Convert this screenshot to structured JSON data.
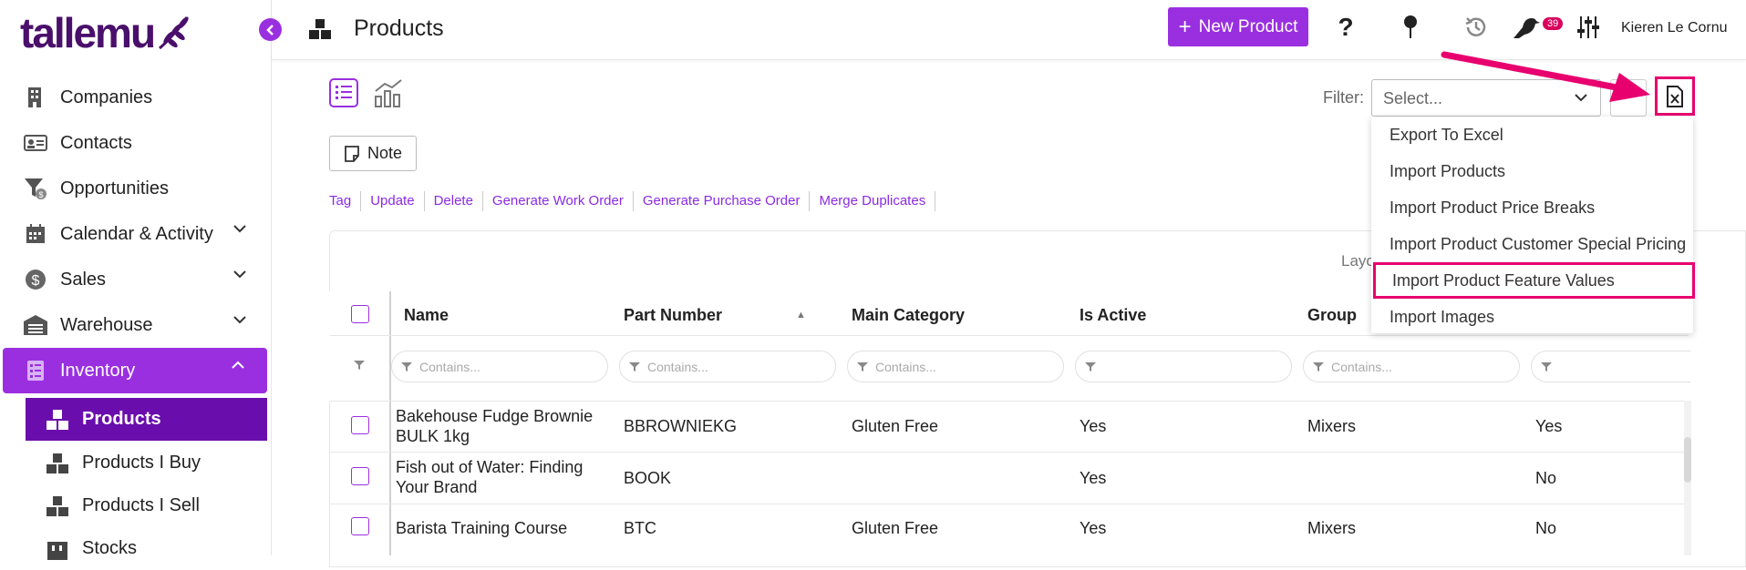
{
  "app": {
    "logo_text": "tallemu"
  },
  "sidebar": {
    "items": [
      {
        "label": "Companies",
        "icon": "building-icon"
      },
      {
        "label": "Contacts",
        "icon": "contact-card-icon"
      },
      {
        "label": "Opportunities",
        "icon": "funnel-icon"
      },
      {
        "label": "Calendar & Activity",
        "icon": "calendar-icon"
      },
      {
        "label": "Sales",
        "icon": "dollar-icon"
      },
      {
        "label": "Warehouse",
        "icon": "warehouse-icon"
      },
      {
        "label": "Inventory",
        "icon": "inventory-icon"
      }
    ],
    "sub_items": [
      {
        "label": "Products"
      },
      {
        "label": "Products I Buy"
      },
      {
        "label": "Products I Sell"
      },
      {
        "label": "Stocks"
      }
    ]
  },
  "header": {
    "title": "Products",
    "new_button": "New Product",
    "notification_count": "39",
    "user_name": "Kieren Le Cornu"
  },
  "toolbar": {
    "filter_label": "Filter:",
    "filter_placeholder": "Select...",
    "note_label": "Note",
    "actions": [
      "Tag",
      "Update",
      "Delete",
      "Generate Work Order",
      "Generate Purchase Order",
      "Merge Duplicates"
    ]
  },
  "grid": {
    "layout_label": "Layo",
    "columns": [
      "Name",
      "Part Number",
      "Main Category",
      "Is Active",
      "Group"
    ],
    "filter_placeholder": "Contains...",
    "rows": [
      {
        "name": "Bakehouse Fudge Brownie BULK 1kg",
        "part": "BBROWNIEKG",
        "category": "Gluten Free",
        "active": "Yes",
        "group": "Mixers",
        "extra": "Yes"
      },
      {
        "name": "Fish out of Water: Finding Your Brand",
        "part": "BOOK",
        "category": "",
        "active": "Yes",
        "group": "",
        "extra": "No"
      },
      {
        "name": "Barista Training Course",
        "part": "BTC",
        "category": "Gluten Free",
        "active": "Yes",
        "group": "Mixers",
        "extra": "No"
      }
    ]
  },
  "menu": {
    "items": [
      "Export To Excel",
      "Import Products",
      "Import Product Price Breaks",
      "Import Product Customer Special Pricing",
      "Import Product Feature Values",
      "Import Images"
    ]
  },
  "colors": {
    "accent": "#9a2fe0",
    "accent_dark": "#6a0dad",
    "highlight": "#e8006f",
    "logo": "#4a0f6b"
  }
}
